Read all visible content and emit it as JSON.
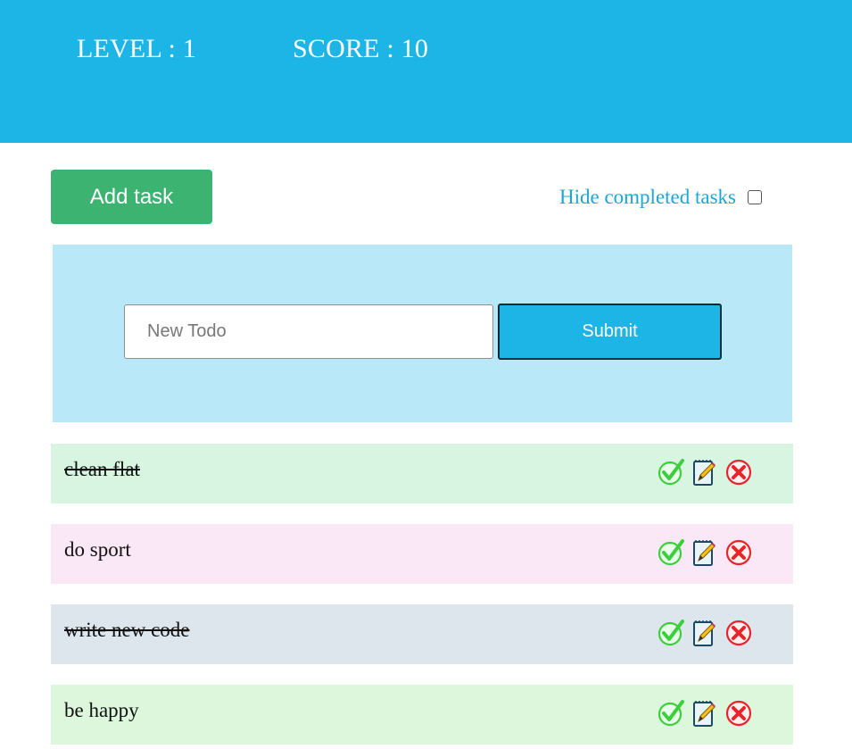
{
  "header": {
    "level_text": "LEVEL : 1",
    "score_text": "SCORE : 10",
    "background": "#1cb5e5"
  },
  "controls": {
    "add_task_label": "Add task",
    "hide_completed_label": "Hide completed tasks",
    "hide_completed_checked": false
  },
  "form": {
    "input_placeholder": "New Todo",
    "input_value": "",
    "submit_label": "Submit"
  },
  "tasks": [
    {
      "text": "clean flat",
      "completed": true,
      "color": "#d7f5e0"
    },
    {
      "text": "do sport",
      "completed": false,
      "color": "#fbe8f6"
    },
    {
      "text": "write new code",
      "completed": true,
      "color": "#dde5ed"
    },
    {
      "text": "be happy",
      "completed": false,
      "color": "#dcf7dc"
    }
  ],
  "task_icons": [
    "check-icon",
    "edit-icon",
    "delete-icon"
  ],
  "colors": {
    "accent": "#1cb5e5",
    "add_button": "#3cb371",
    "form_panel": "#b9e8f8",
    "check": "#3ccf3c",
    "delete": "#e8242a"
  }
}
